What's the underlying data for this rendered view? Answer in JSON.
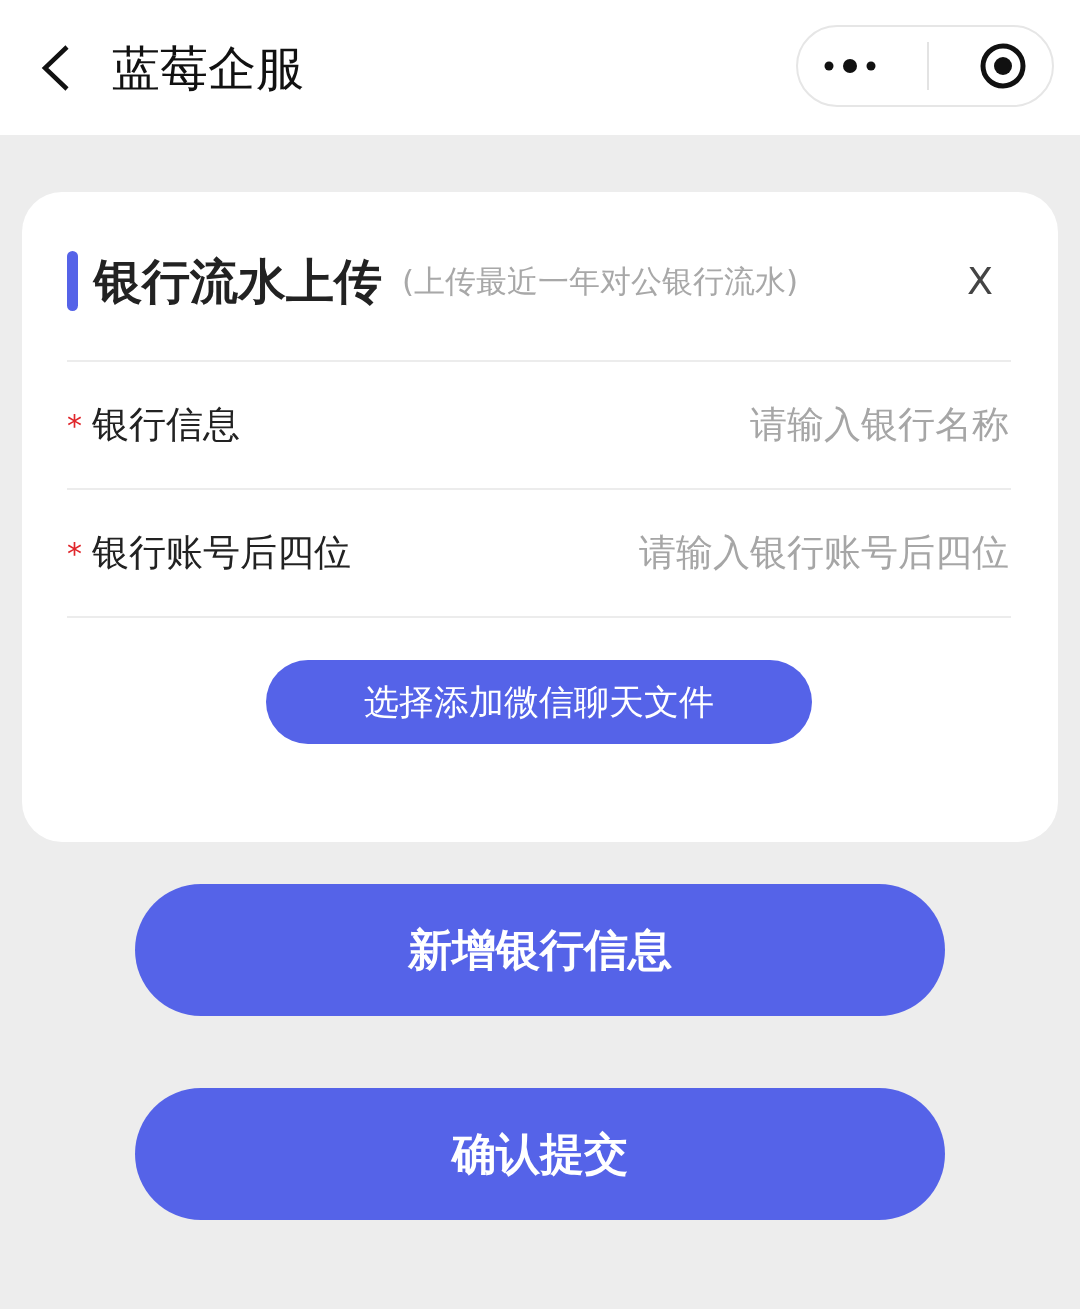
{
  "header": {
    "title": "蓝莓企服"
  },
  "card": {
    "title": "银行流水上传",
    "hint": "(上传最近一年对公银行流水)",
    "close": "X",
    "fields": [
      {
        "mark": "*",
        "label": "银行信息",
        "placeholder": "请输入银行名称"
      },
      {
        "mark": "*",
        "label": "银行账号后四位",
        "placeholder": "请输入银行账号后四位"
      }
    ],
    "upload_button": "选择添加微信聊天文件"
  },
  "buttons": [
    "新增银行信息",
    "确认提交"
  ]
}
